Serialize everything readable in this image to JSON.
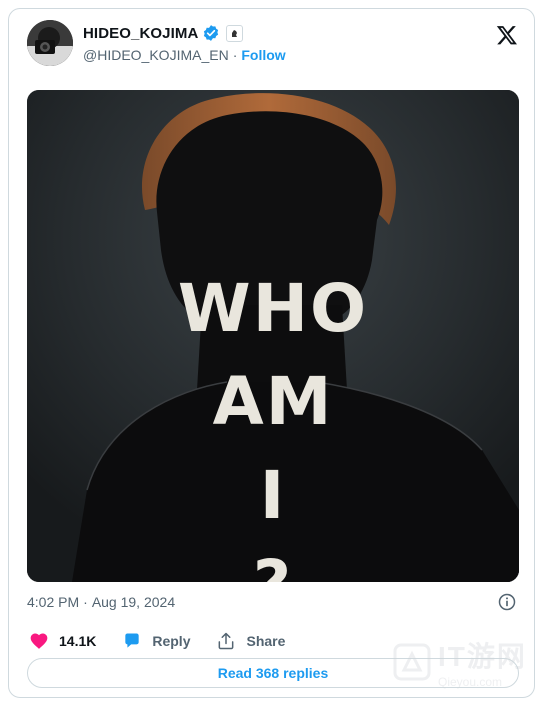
{
  "author": {
    "name": "HIDEO_KOJIMA",
    "handle": "@HIDEO_KOJIMA_EN",
    "separator": "·",
    "follow_label": "Follow"
  },
  "media": {
    "lines": [
      "WHO",
      "AM",
      "I",
      "?"
    ]
  },
  "timestamp": {
    "time": "4:02 PM",
    "separator": "·",
    "date": "Aug 19, 2024"
  },
  "actions": {
    "likes": "14.1K",
    "reply_label": "Reply",
    "share_label": "Share"
  },
  "read_replies_label": "Read 368 replies",
  "watermark": {
    "text": "Qieyou.com"
  },
  "colors": {
    "accent": "#1d9bf0",
    "like": "#f91880",
    "muted": "#536471",
    "border": "#cfd9de"
  },
  "icons": [
    "verified-badge-icon",
    "affiliate-badge-icon",
    "x-logo-icon",
    "info-icon",
    "heart-icon",
    "reply-bubble-icon",
    "share-icon"
  ]
}
